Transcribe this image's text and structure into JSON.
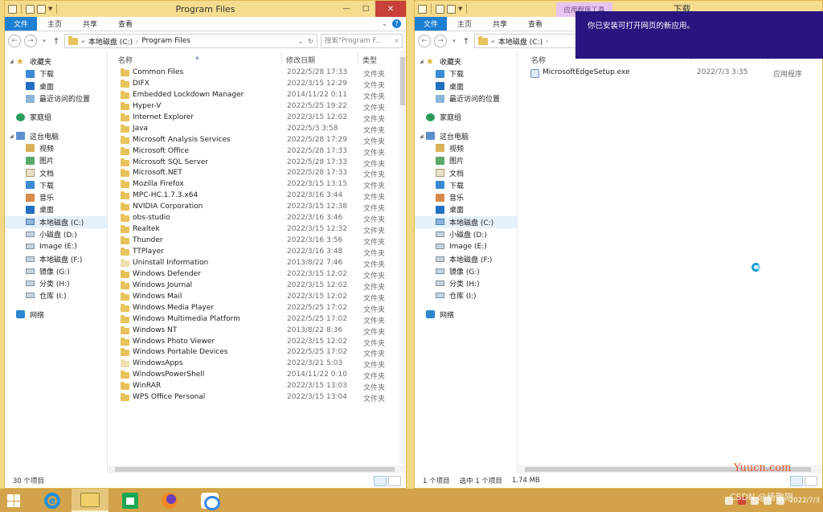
{
  "left_window": {
    "title": "Program Files",
    "ribbon_tabs": [
      "文件",
      "主页",
      "共享",
      "查看"
    ],
    "address": [
      "«",
      "本地磁盘 (C:)",
      "›",
      "Program Files"
    ],
    "search_placeholder": "搜索\"Program F...",
    "columns": {
      "name": "名称",
      "date": "修改日期",
      "type": "类型"
    },
    "nav": [
      {
        "label": "收藏夹",
        "icon": "star-icon",
        "level": 0,
        "arrow": "expanded"
      },
      {
        "label": "下载",
        "icon": "downloads-folder-icon",
        "level": 1
      },
      {
        "label": "桌面",
        "icon": "desktop-icon",
        "level": 1
      },
      {
        "label": "最近访问的位置",
        "icon": "recent-places-icon",
        "level": 1
      },
      {
        "label": "家庭组",
        "icon": "homegroup-icon",
        "level": 0,
        "gap": true
      },
      {
        "label": "这台电脑",
        "icon": "computer-icon",
        "level": 0,
        "arrow": "expanded",
        "gap": true
      },
      {
        "label": "视频",
        "icon": "videos-folder-icon",
        "level": 1
      },
      {
        "label": "图片",
        "icon": "pictures-folder-icon",
        "level": 1
      },
      {
        "label": "文档",
        "icon": "documents-folder-icon",
        "level": 1
      },
      {
        "label": "下载",
        "icon": "downloads-folder-icon",
        "level": 1
      },
      {
        "label": "音乐",
        "icon": "music-folder-icon",
        "level": 1
      },
      {
        "label": "桌面",
        "icon": "desktop-icon",
        "level": 1
      },
      {
        "label": "本地磁盘 (C:)",
        "icon": "system-drive-icon",
        "level": 1,
        "selected": true
      },
      {
        "label": "小磁盘 (D:)",
        "icon": "drive-icon",
        "level": 1
      },
      {
        "label": "Image (E:)",
        "icon": "drive-icon",
        "level": 1
      },
      {
        "label": "本地磁盘 (F:)",
        "icon": "drive-icon",
        "level": 1
      },
      {
        "label": "镜像 (G:)",
        "icon": "drive-icon",
        "level": 1
      },
      {
        "label": "分类 (H:)",
        "icon": "drive-icon",
        "level": 1
      },
      {
        "label": "仓库 (I:)",
        "icon": "drive-icon",
        "level": 1
      },
      {
        "label": "网络",
        "icon": "network-icon",
        "level": 0,
        "gap": true
      }
    ],
    "files": [
      {
        "name": "Common Files",
        "date": "2022/5/28 17:33",
        "type": "文件夹"
      },
      {
        "name": "DIFX",
        "date": "2022/3/15 12:29",
        "type": "文件夹"
      },
      {
        "name": "Embedded Lockdown Manager",
        "date": "2014/11/22 0:11",
        "type": "文件夹"
      },
      {
        "name": "Hyper-V",
        "date": "2022/5/25 19:22",
        "type": "文件夹"
      },
      {
        "name": "Internet Explorer",
        "date": "2022/3/15 12:02",
        "type": "文件夹"
      },
      {
        "name": "Java",
        "date": "2022/5/3 3:58",
        "type": "文件夹"
      },
      {
        "name": "Microsoft Analysis Services",
        "date": "2022/5/28 17:29",
        "type": "文件夹"
      },
      {
        "name": "Microsoft Office",
        "date": "2022/5/28 17:33",
        "type": "文件夹"
      },
      {
        "name": "Microsoft SQL Server",
        "date": "2022/5/28 17:33",
        "type": "文件夹"
      },
      {
        "name": "Microsoft.NET",
        "date": "2022/5/28 17:33",
        "type": "文件夹"
      },
      {
        "name": "Mozilla Firefox",
        "date": "2022/3/15 13:15",
        "type": "文件夹"
      },
      {
        "name": "MPC-HC.1.7.3.x64",
        "date": "2022/3/16 3:44",
        "type": "文件夹"
      },
      {
        "name": "NVIDIA Corporation",
        "date": "2022/3/15 12:38",
        "type": "文件夹"
      },
      {
        "name": "obs-studio",
        "date": "2022/3/16 3:46",
        "type": "文件夹"
      },
      {
        "name": "Realtek",
        "date": "2022/3/15 12:32",
        "type": "文件夹"
      },
      {
        "name": "Thunder",
        "date": "2022/3/16 3:56",
        "type": "文件夹"
      },
      {
        "name": "TTPlayer",
        "date": "2022/3/16 3:48",
        "type": "文件夹"
      },
      {
        "name": "Uninstall Information",
        "date": "2013/8/22 7:46",
        "type": "文件夹",
        "pale": true
      },
      {
        "name": "Windows Defender",
        "date": "2022/3/15 12:02",
        "type": "文件夹"
      },
      {
        "name": "Windows Journal",
        "date": "2022/3/15 12:02",
        "type": "文件夹"
      },
      {
        "name": "Windows Mail",
        "date": "2022/3/15 12:02",
        "type": "文件夹"
      },
      {
        "name": "Windows Media Player",
        "date": "2022/5/25 17:02",
        "type": "文件夹"
      },
      {
        "name": "Windows Multimedia Platform",
        "date": "2022/5/25 17:02",
        "type": "文件夹"
      },
      {
        "name": "Windows NT",
        "date": "2013/8/22 8:36",
        "type": "文件夹"
      },
      {
        "name": "Windows Photo Viewer",
        "date": "2022/3/15 12:02",
        "type": "文件夹"
      },
      {
        "name": "Windows Portable Devices",
        "date": "2022/5/25 17:02",
        "type": "文件夹"
      },
      {
        "name": "WindowsApps",
        "date": "2022/3/21 5:03",
        "type": "文件夹",
        "pale": true
      },
      {
        "name": "WindowsPowerShell",
        "date": "2014/11/22 0:10",
        "type": "文件夹"
      },
      {
        "name": "WinRAR",
        "date": "2022/3/15 13:03",
        "type": "文件夹"
      },
      {
        "name": "WPS Office Personal",
        "date": "2022/3/15 13:04",
        "type": "文件夹"
      }
    ],
    "status": "30 个项目"
  },
  "right_window": {
    "title": "下载",
    "context_tab": "应用程序工具",
    "ribbon_tabs": [
      "文件",
      "主页",
      "共享",
      "查看"
    ],
    "address": [
      "«",
      "本地磁盘 (C:)",
      "›"
    ],
    "columns": {
      "name": "名称"
    },
    "files": [
      {
        "name": "MicrosoftEdgeSetup.exe",
        "date": "2022/7/3 3:35",
        "type": "应用程序"
      }
    ],
    "status_count": "1 个项目",
    "status_selected": "选中 1 个项目",
    "status_size": "1.74 MB"
  },
  "toast": {
    "message": "你已安装可打开网页的新应用。"
  },
  "taskbar": {
    "date": "2022/7/3",
    "watermark": "CSDN @杨敬刚"
  },
  "site_watermark": "Yuucn.com"
}
